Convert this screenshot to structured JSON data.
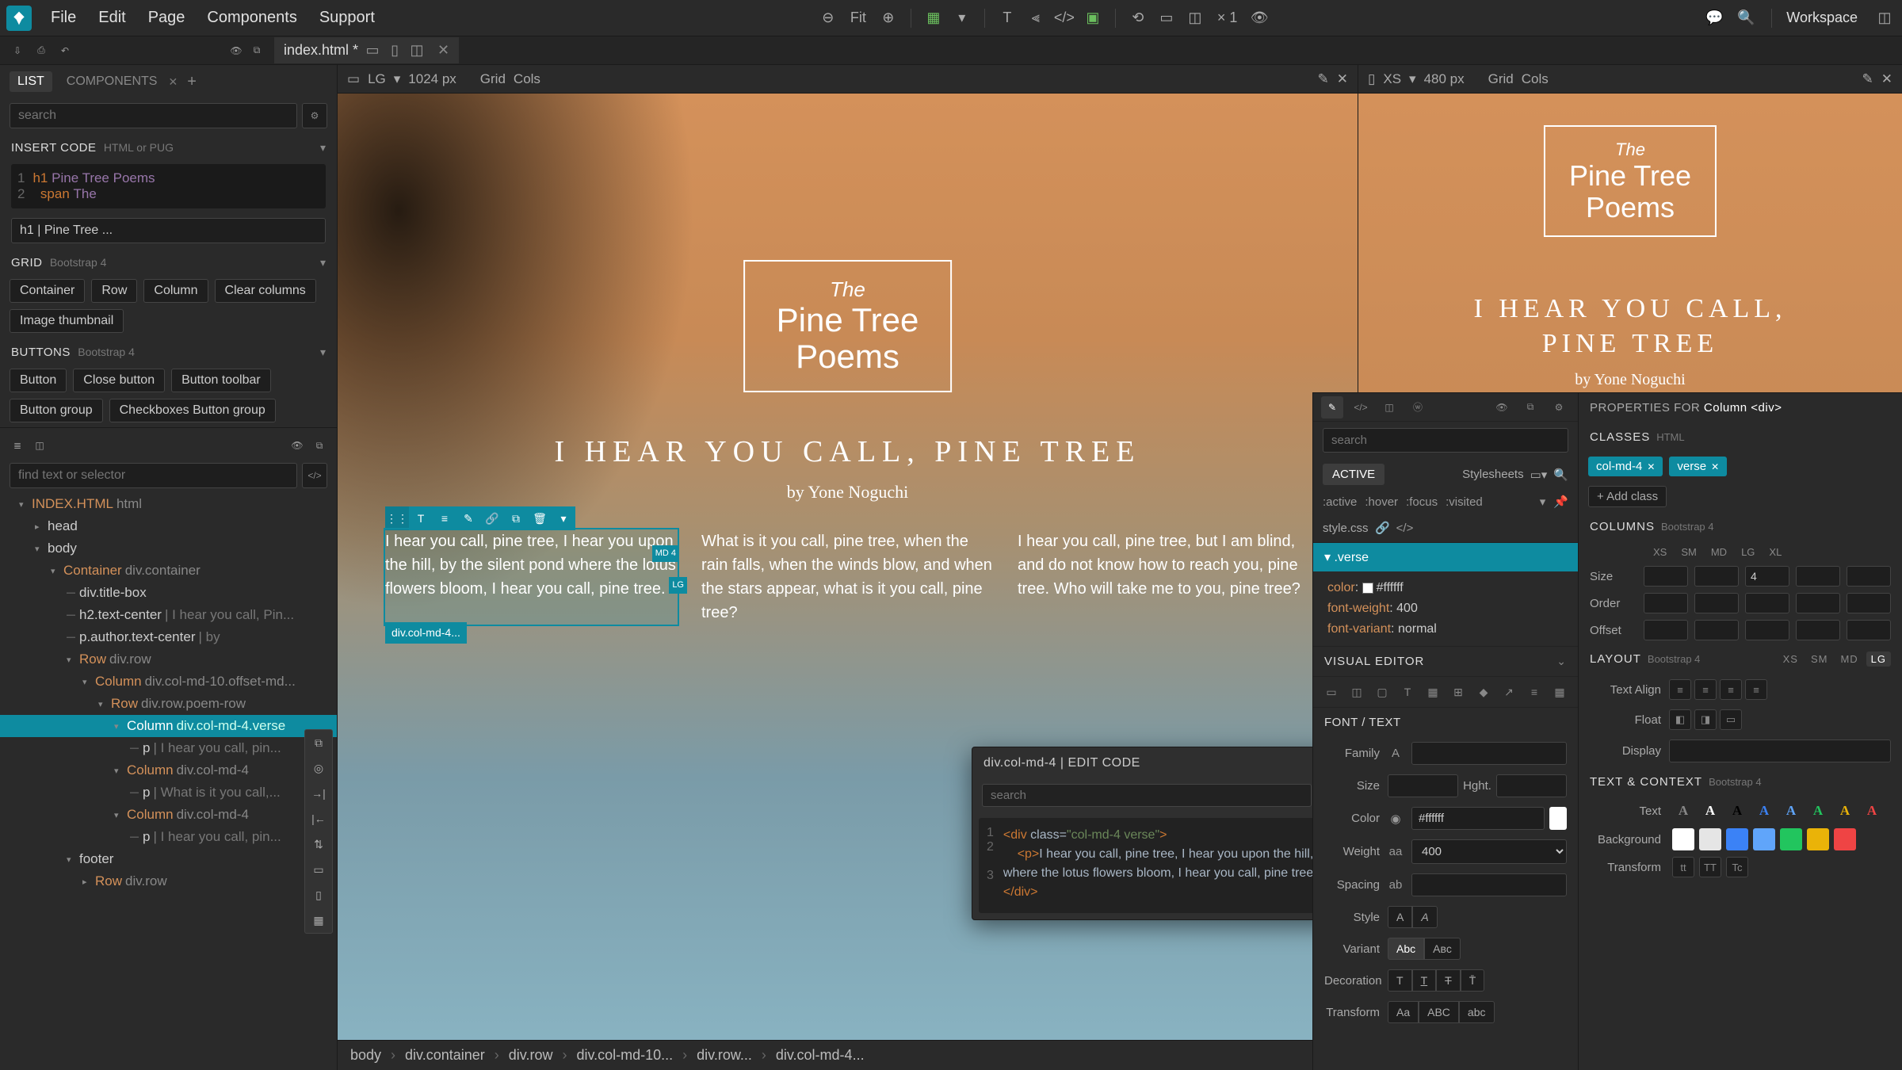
{
  "menu": {
    "file": "File",
    "edit": "Edit",
    "page": "Page",
    "components": "Components",
    "support": "Support"
  },
  "topbar": {
    "fit": "Fit",
    "multiplier": "× 1",
    "workspace": "Workspace"
  },
  "tabs": {
    "fileName": "index.html *"
  },
  "leftPanel": {
    "tabList": "LIST",
    "tabComponents": "COMPONENTS",
    "searchPlaceholder": "search",
    "insertCode": {
      "title": "INSERT CODE",
      "sub": "HTML or PUG",
      "line1tag": "h1",
      "line1txt": "Pine Tree Poems",
      "line2tag": "span",
      "line2txt": "The"
    },
    "breadcrumbVal": "h1 | Pine Tree ...",
    "grid": {
      "title": "GRID",
      "sub": "Bootstrap 4",
      "chips": [
        "Container",
        "Row",
        "Column",
        "Clear columns",
        "Image thumbnail"
      ]
    },
    "buttons": {
      "title": "BUTTONS",
      "sub": "Bootstrap 4",
      "chips": [
        "Button",
        "Close button",
        "Button toolbar",
        "Button group",
        "Checkboxes Button group"
      ]
    },
    "treeSearchPlaceholder": "find text or selector",
    "tree": {
      "root": "INDEX.HTML",
      "rootTag": "html",
      "head": "head",
      "body": "body",
      "container": "Container",
      "containerTag": "div.container",
      "titleBox": "div.title-box",
      "h2": "h2.text-center",
      "h2txt": " | I hear you call, Pin...",
      "pAuthor": "p.author.text-center",
      "pAuthorTxt": " | by",
      "row1": "Row",
      "row1Tag": "div.row",
      "col1": "Column",
      "col1Tag": "div.col-md-10.offset-md...",
      "row2": "Row",
      "row2Tag": "div.row.poem-row",
      "col2": "Column",
      "col2Tag": "div.col-md-4.verse",
      "p1": "p",
      "p1txt": " | I hear you call, pin...",
      "col3": "Column",
      "col3Tag": "div.col-md-4",
      "p2": "p",
      "p2txt": " | What is it you call,...",
      "col4": "Column",
      "col4Tag": "div.col-md-4",
      "p3": "p",
      "p3txt": " | I hear you call, pin...",
      "footer": "footer",
      "rowFooter": "Row",
      "rowFooterTag": "div.row"
    }
  },
  "viewports": {
    "lg": {
      "label": "LG",
      "size": "1024 px",
      "grid": "Grid",
      "cols": "Cols"
    },
    "xs": {
      "label": "XS",
      "size": "480 px",
      "grid": "Grid",
      "cols": "Cols"
    }
  },
  "preview": {
    "the": "The",
    "title1": "Pine Tree",
    "title2": "Poems",
    "heading": "I HEAR YOU CALL, PINE TREE",
    "author": "by Yone Noguchi",
    "verse1": "I hear you call, pine tree, I hear you upon the hill, by the silent pond where the lotus flowers bloom, I hear you call, pine tree.",
    "verse2": "What is it you call, pine tree, when the rain falls, when the winds blow, and when the stars appear, what is it you call, pine tree?",
    "verse3": "I hear you call, pine tree, but I am blind, and do not know how to reach you, pine tree. Who will take me to you, pine tree?",
    "badgeMd": "MD 4",
    "badgeLg": "LG",
    "selLabel": "div.col-md-4..."
  },
  "editPopup": {
    "title": "div.col-md-4 | EDIT CODE",
    "searchPlaceholder": "search",
    "line1": "<div class=\"col-md-4 verse\">",
    "line2": "    <p>I hear you call, pine tree, I hear you upon the hill, by the silent pond where the lotus flowers bloom, I hear you call, pine tree.</p>",
    "line3": "</div>"
  },
  "bottomCrumb": [
    "body",
    "div.container",
    "div.row",
    "div.col-md-10...",
    "div.row...",
    "div.col-md-4..."
  ],
  "stylePanel": {
    "searchPlaceholder": "search",
    "active": "ACTIVE",
    "stylesheets": "Stylesheets",
    "pseudo": [
      ":active",
      ":hover",
      ":focus",
      ":visited"
    ],
    "styleFile": "style.css",
    "ruleSelector": ".verse",
    "props": [
      {
        "name": "color",
        "val": "#ffffff",
        "swatch": "#ffffff"
      },
      {
        "name": "font-weight",
        "val": "400"
      },
      {
        "name": "font-variant",
        "val": "normal"
      }
    ],
    "visualEditor": "VISUAL EDITOR",
    "fontText": "FONT / TEXT",
    "family": "Family",
    "size": "Size",
    "height": "Hght.",
    "color": "Color",
    "colorVal": "#ffffff",
    "weight": "Weight",
    "weightVal": "400",
    "spacing": "Spacing",
    "style": "Style",
    "variant": "Variant",
    "variantOpts": [
      "Abc",
      "Aʙᴄ"
    ],
    "decoration": "Decoration",
    "transform": "Transform",
    "transformOpts": [
      "Aa",
      "ABC",
      "abc"
    ]
  },
  "propPanel": {
    "propsFor": "PROPERTIES FOR",
    "propsForTarget": "Column <div>",
    "classes": "CLASSES",
    "classesSub": "HTML",
    "classChips": [
      "col-md-4",
      "verse"
    ],
    "addClass": "+ Add class",
    "columns": "COLUMNS",
    "columnsSub": "Bootstrap 4",
    "bpLabels": [
      "XS",
      "SM",
      "MD",
      "LG",
      "XL"
    ],
    "sizeLabel": "Size",
    "sizeMdVal": "4",
    "orderLabel": "Order",
    "offsetLabel": "Offset",
    "layout": "LAYOUT",
    "layoutSub": "Bootstrap 4",
    "layoutBp": [
      "XS",
      "SM",
      "MD",
      "LG"
    ],
    "textAlign": "Text Align",
    "float": "Float",
    "display": "Display",
    "textContext": "TEXT & CONTEXT",
    "textContextSub": "Bootstrap 4",
    "text": "Text",
    "background": "Background",
    "transform": "Transform"
  }
}
